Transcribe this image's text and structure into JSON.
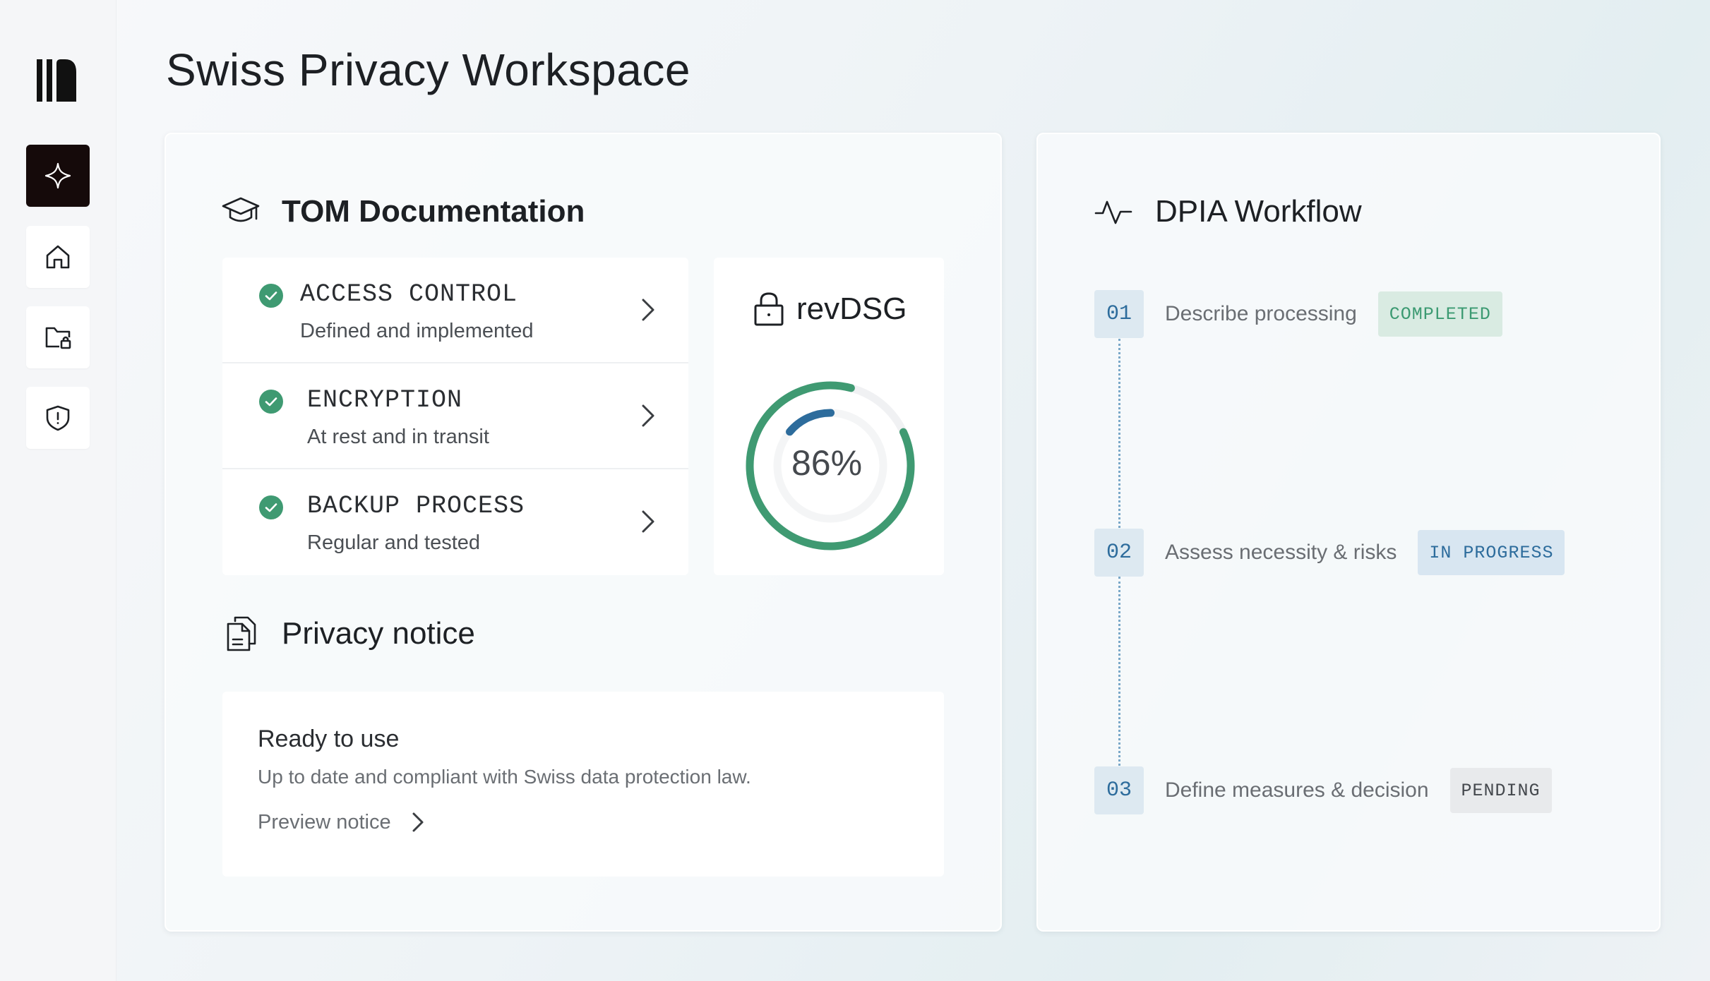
{
  "page": {
    "title": "Swiss Privacy Workspace"
  },
  "sidebar": {
    "logo_icon": "library-logo-icon",
    "items": [
      {
        "icon": "sparkle-icon",
        "active": true
      },
      {
        "icon": "home-icon",
        "active": false
      },
      {
        "icon": "folder-lock-icon",
        "active": false
      },
      {
        "icon": "shield-alert-icon",
        "active": false
      }
    ]
  },
  "tom": {
    "title": "TOM Documentation",
    "items": [
      {
        "name": "ACCESS CONTROL",
        "status": "Defined and implemented"
      },
      {
        "name": "ENCRYPTION",
        "status": "At rest and in transit"
      },
      {
        "name": "BACKUP PROCESS",
        "status": "Regular and tested"
      }
    ]
  },
  "revdsg": {
    "label": "revDSG",
    "progress_text": "86%",
    "progress": 0.86
  },
  "privacy_notice": {
    "title": "Privacy notice",
    "card_title": "Ready to use",
    "description": "Up to date and compliant with Swiss data protection law.",
    "link": "Preview notice"
  },
  "dpia": {
    "title": "DPIA Workflow",
    "steps": [
      {
        "num": "01",
        "label": "Describe processing",
        "status": "COMPLETED"
      },
      {
        "num": "02",
        "label": "Assess necessity & risks",
        "status": "IN PROGRESS"
      },
      {
        "num": "03",
        "label": "Define measures & decision",
        "status": "PENDING"
      }
    ]
  },
  "colors": {
    "success": "#3f9a72",
    "info": "#2d6c9c",
    "active_nav": "#150a0a"
  }
}
